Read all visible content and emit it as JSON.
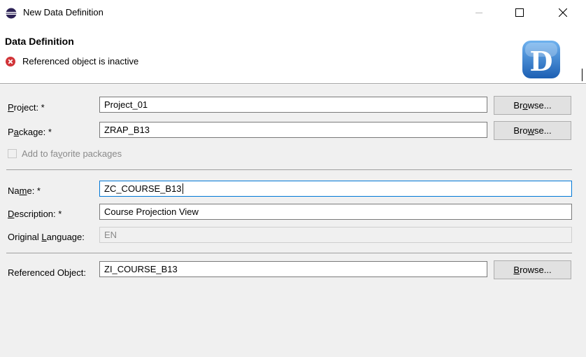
{
  "window": {
    "title": "New Data Definition",
    "minimize_icon": "minimize-icon",
    "maximize_icon": "maximize-icon",
    "close_icon": "close-icon"
  },
  "header": {
    "title": "Data Definition",
    "message": "Referenced object is inactive",
    "message_icon": "error-icon",
    "banner_letter": "D"
  },
  "form": {
    "project": {
      "label_pre": "",
      "label_ul": "P",
      "label_post": "roject: *",
      "value": "Project_01",
      "browse_pre": "Br",
      "browse_ul": "o",
      "browse_post": "wse..."
    },
    "package": {
      "label_pre": "P",
      "label_ul": "a",
      "label_post": "ckage: *",
      "value": "ZRAP_B13",
      "browse_pre": "Bro",
      "browse_ul": "w",
      "browse_post": "se..."
    },
    "favorite": {
      "label_pre": "Add to fa",
      "label_ul": "v",
      "label_post": "orite packages",
      "checked": false,
      "enabled": false
    },
    "name": {
      "label_pre": "Na",
      "label_ul": "m",
      "label_post": "e: *",
      "value": "ZC_COURSE_B13"
    },
    "description": {
      "label_pre": "",
      "label_ul": "D",
      "label_post": "escription: *",
      "value": "Course Projection View"
    },
    "language": {
      "label_pre": "Original ",
      "label_ul": "L",
      "label_post": "anguage:",
      "value": "EN"
    },
    "referenced": {
      "label_pre": "Referenced Object:",
      "label_ul": "",
      "label_post": "",
      "value": "ZI_COURSE_B13",
      "browse_pre": "",
      "browse_ul": "B",
      "browse_post": "rowse..."
    }
  },
  "colors": {
    "focus_border": "#0078d7",
    "body_bg": "#f0f0f0",
    "error_red": "#d13438",
    "banner_blue": "#1f6fc5"
  }
}
